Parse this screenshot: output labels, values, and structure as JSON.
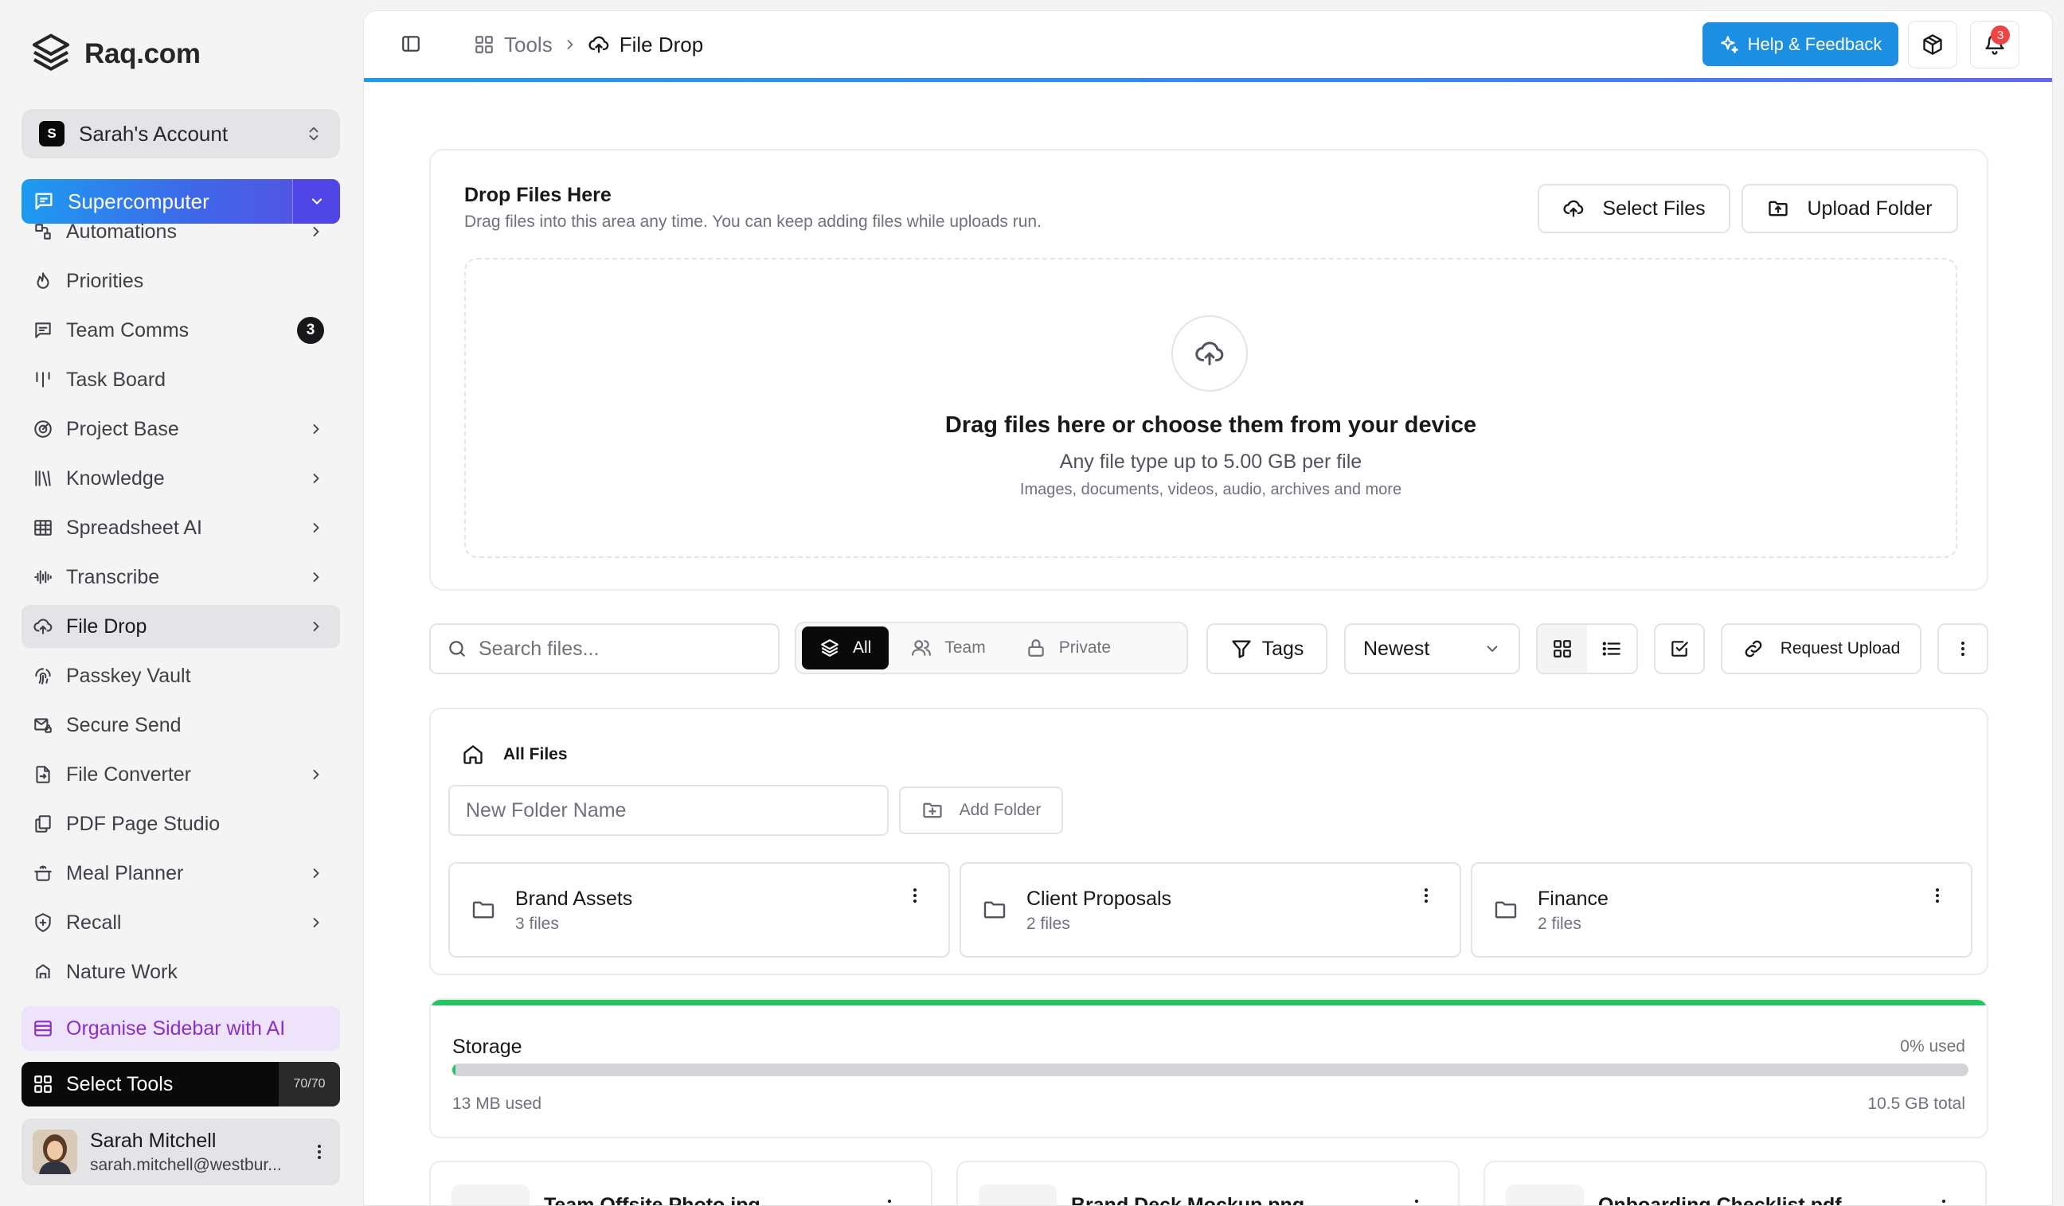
{
  "sidebar": {
    "brand": "Raq.com",
    "account": {
      "badge": "S",
      "name": "Sarah's Account"
    },
    "primary_tool": "Supercomputer",
    "items": [
      {
        "label": "Automations",
        "icon": "automation-icon",
        "chevron": true
      },
      {
        "label": "Priorities",
        "icon": "flame-icon"
      },
      {
        "label": "Team Comms",
        "icon": "chat-icon",
        "badge": "3"
      },
      {
        "label": "Task Board",
        "icon": "kanban-icon"
      },
      {
        "label": "Project Base",
        "icon": "target-icon",
        "chevron": true
      },
      {
        "label": "Knowledge",
        "icon": "library-icon",
        "chevron": true
      },
      {
        "label": "Spreadsheet AI",
        "icon": "table-icon",
        "chevron": true
      },
      {
        "label": "Transcribe",
        "icon": "waveform-icon",
        "chevron": true
      },
      {
        "label": "File Drop",
        "icon": "cloud-upload-icon",
        "chevron": true,
        "active": true
      },
      {
        "label": "Passkey Vault",
        "icon": "fingerprint-icon"
      },
      {
        "label": "Secure Send",
        "icon": "secure-mail-icon"
      },
      {
        "label": "File Converter",
        "icon": "file-convert-icon",
        "chevron": true
      },
      {
        "label": "PDF Page Studio",
        "icon": "pages-icon"
      },
      {
        "label": "Meal Planner",
        "icon": "cooking-pot-icon",
        "chevron": true
      },
      {
        "label": "Recall",
        "icon": "recall-icon",
        "chevron": true
      },
      {
        "label": "Nature Work",
        "icon": "nature-icon"
      }
    ],
    "organise_label": "Organise Sidebar with AI",
    "select_tools_label": "Select Tools",
    "tools_count": "70/70",
    "user": {
      "name": "Sarah Mitchell",
      "email": "sarah.mitchell@westbur..."
    }
  },
  "topbar": {
    "breadcrumb_root": "Tools",
    "breadcrumb_current": "File Drop",
    "help_label": "Help & Feedback",
    "notification_count": "3"
  },
  "dropzone": {
    "title": "Drop Files Here",
    "subtitle": "Drag files into this area any time. You can keep adding files while uploads run.",
    "select_files_label": "Select Files",
    "upload_folder_label": "Upload Folder",
    "heading": "Drag files here or choose them from your device",
    "limit_text": "Any file type up to 5.00 GB per file",
    "types_text": "Images, documents, videos, audio, archives and more"
  },
  "toolbar": {
    "search_placeholder": "Search files...",
    "filters": [
      "All",
      "Team",
      "Private"
    ],
    "active_filter": "All",
    "tags_label": "Tags",
    "sort_value": "Newest",
    "request_upload_label": "Request Upload"
  },
  "folders": {
    "breadcrumb": "All Files",
    "new_folder_placeholder": "New Folder Name",
    "add_folder_label": "Add Folder",
    "items": [
      {
        "name": "Brand Assets",
        "count": "3 files"
      },
      {
        "name": "Client Proposals",
        "count": "2 files"
      },
      {
        "name": "Finance",
        "count": "2 files"
      }
    ]
  },
  "storage": {
    "title": "Storage",
    "percent_label": "0% used",
    "used_fraction": 0.0012,
    "used_label": "13 MB used",
    "total_label": "10.5 GB total"
  },
  "files": [
    {
      "name": "Team Offsite Photo.jpg"
    },
    {
      "name": "Brand Deck Mockup.png"
    },
    {
      "name": "Onboarding Checklist.pdf"
    }
  ],
  "colors": {
    "accent_blue": "#1d8fe3",
    "storage_green": "#22c55e",
    "organise_purple": "#8b2fc9",
    "notification_red": "#ef4444"
  }
}
